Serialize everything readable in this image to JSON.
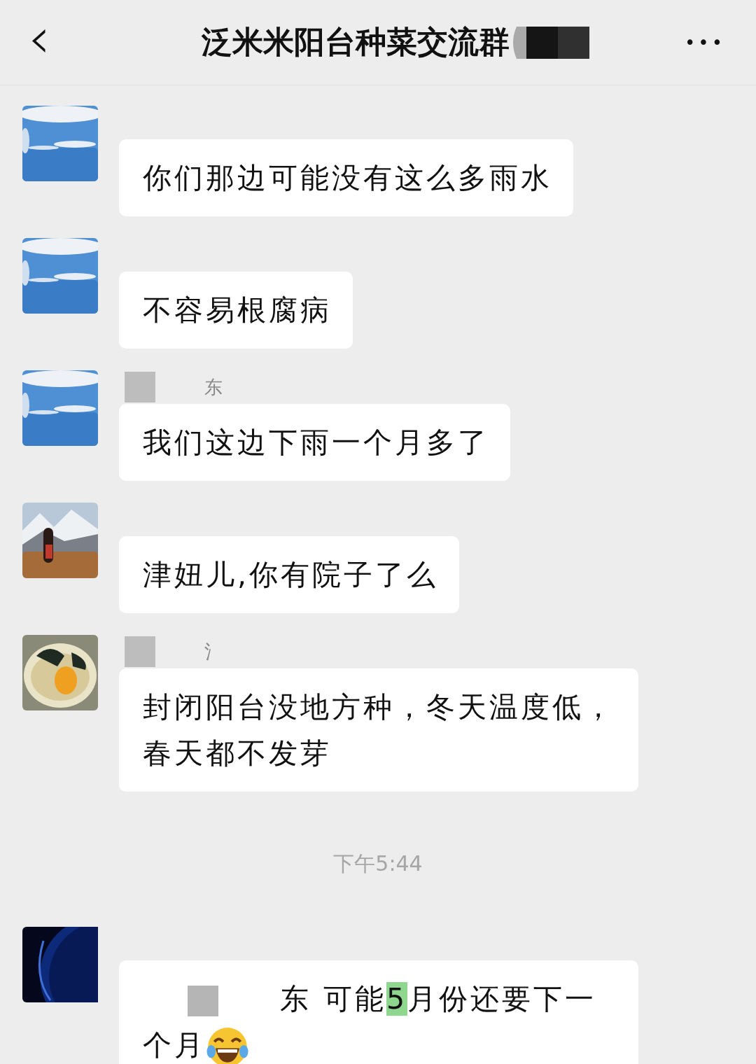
{
  "header": {
    "back": "‹",
    "title": "泛米米阳台种菜交流群",
    "redacted": true,
    "more": "•••"
  },
  "messages": [
    {
      "kind": "text",
      "text": "你们那边可能没有这么多雨水"
    },
    {
      "kind": "text",
      "text": "不容易根腐病"
    },
    {
      "kind": "text",
      "sender": {
        "name": "东",
        "redacted": true
      },
      "text": "我们这边下雨一个月多了"
    },
    {
      "kind": "text",
      "text": "津妞儿,你有院子了么"
    },
    {
      "kind": "text",
      "sender": {
        "name": "氵",
        "redacted": true
      },
      "text": "封闭阳台没地方种，冬天温度低，春天都不发芽"
    },
    {
      "kind": "time",
      "text": "下午5:44"
    },
    {
      "kind": "mention",
      "redacted": true,
      "parts": [
        {
          "text": "东  可能",
          "highlight": false
        },
        {
          "text": "5",
          "highlight": true
        },
        {
          "text": "月份还要下一个月",
          "highlight": false
        }
      ],
      "emoji": true
    }
  ]
}
